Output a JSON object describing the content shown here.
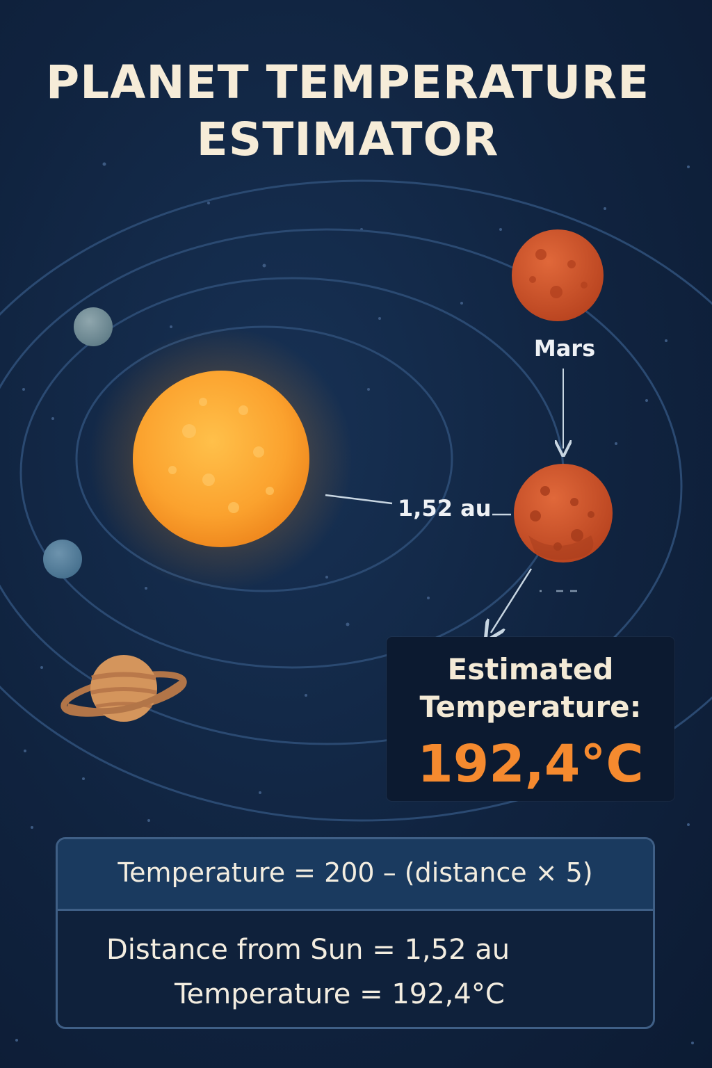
{
  "title": {
    "line1": "PLANET TEMPERATURE",
    "line2": "ESTIMATOR"
  },
  "planet_label": "Mars",
  "distance_label": "1,52 au",
  "result": {
    "heading_line1": "Estimated",
    "heading_line2": "Temperature:",
    "value": "192,4°C"
  },
  "formula": {
    "expression": "Temperature  =  200 – (distance × 5)",
    "distance_line": "Distance from Sun  =  1,52 au",
    "temperature_line": "Temperature  =   192,4°C"
  },
  "colors": {
    "background": "#10233f",
    "sun": "#f7a131",
    "mars": "#d4552a",
    "accent": "#f58a2f",
    "orbit": "#2b4a72"
  }
}
